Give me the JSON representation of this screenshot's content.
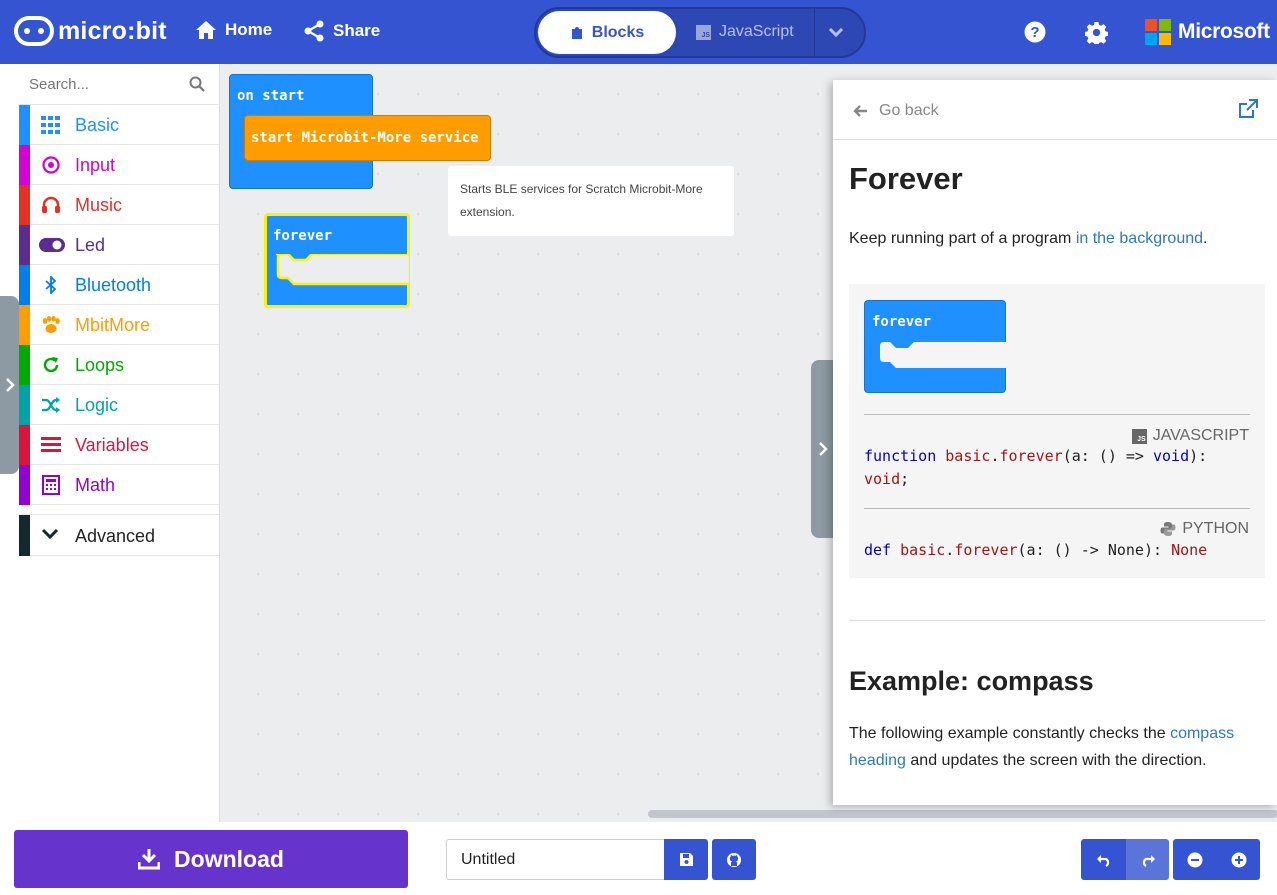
{
  "header": {
    "logo_text": "micro:bit",
    "home_label": "Home",
    "share_label": "Share",
    "blocks_label": "Blocks",
    "javascript_label": "JavaScript",
    "microsoft_label": "Microsoft",
    "js_badge": "JS"
  },
  "toolbox": {
    "search_placeholder": "Search...",
    "categories": [
      {
        "label": "Basic",
        "color": "#1e90ff",
        "icon": "grid-icon"
      },
      {
        "label": "Input",
        "color": "#d400d4",
        "icon": "target-icon"
      },
      {
        "label": "Music",
        "color": "#e63022",
        "icon": "headphones-icon"
      },
      {
        "label": "Led",
        "color": "#5c2d91",
        "icon": "toggle-icon"
      },
      {
        "label": "Bluetooth",
        "color": "#007eeb",
        "icon": "bluetooth-icon"
      },
      {
        "label": "MbitMore",
        "color": "#ff9d00",
        "icon": "paw-icon"
      },
      {
        "label": "Loops",
        "color": "#00aa00",
        "icon": "refresh-icon"
      },
      {
        "label": "Logic",
        "color": "#00a4a6",
        "icon": "shuffle-icon"
      },
      {
        "label": "Variables",
        "color": "#dc143c",
        "icon": "list-icon"
      },
      {
        "label": "Math",
        "color": "#9400d3",
        "icon": "calculator-icon"
      }
    ],
    "advanced_label": "Advanced"
  },
  "workspace": {
    "on_start_label": "on start",
    "mbitmore_block_label": "start Microbit-More service",
    "forever_label": "forever",
    "comment_text": "Starts BLE services for Scratch Microbit-More extension."
  },
  "help": {
    "go_back_label": "Go back",
    "title": "Forever",
    "intro_text": "Keep running part of a program ",
    "intro_link": "in the background",
    "intro_end": ".",
    "block_label": "forever",
    "js_lang_label": "JAVASCRIPT",
    "js_code": {
      "kw": "function",
      "obj": "basic",
      "fn": "forever",
      "args": "(a: () => ",
      "ty": "void",
      "close": "):",
      "ret": "void",
      "end": ";"
    },
    "py_lang_label": "PYTHON",
    "py_code": {
      "kw": "def",
      "obj": "basic",
      "fn": "forever",
      "args": "(a: () -> None): ",
      "ret": "None"
    },
    "example_title": "Example: compass",
    "example_text1": "The following example constantly checks the ",
    "example_link": "compass heading",
    "example_text2": " and updates the screen with the direction."
  },
  "bottom": {
    "download_label": "Download",
    "filename_value": "Untitled"
  },
  "colors": {
    "header_bg": "#3454d1",
    "download_bg": "#6633cc",
    "block_blue": "#1e90ff",
    "block_orange": "#ff9d00",
    "selection_yellow": "#fff200"
  }
}
